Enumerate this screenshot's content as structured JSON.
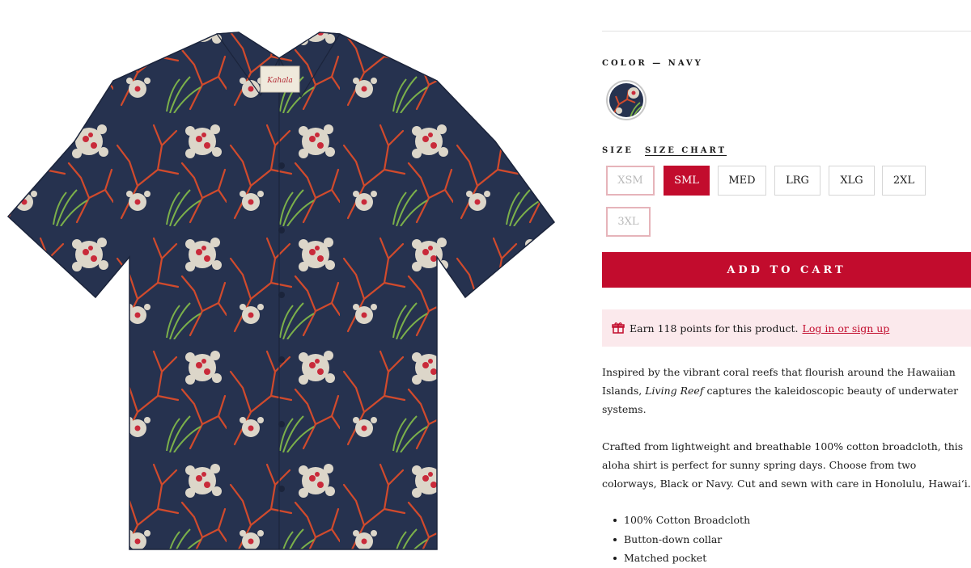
{
  "product": {
    "image_alt": "Living Reef aloha shirt in Navy",
    "brand_tag": "Kahala"
  },
  "color": {
    "label": "COLOR — NAVY",
    "swatches": [
      {
        "name": "Navy",
        "selected": true
      }
    ]
  },
  "size": {
    "label": "SIZE",
    "chart_link": "SIZE CHART",
    "options": [
      {
        "label": "XSM",
        "state": "unavailable"
      },
      {
        "label": "SML",
        "state": "selected"
      },
      {
        "label": "MED",
        "state": "available"
      },
      {
        "label": "LRG",
        "state": "available"
      },
      {
        "label": "XLG",
        "state": "available"
      },
      {
        "label": "2XL",
        "state": "available"
      },
      {
        "label": "3XL",
        "state": "unavailable"
      }
    ]
  },
  "cart": {
    "add_label": "ADD TO CART"
  },
  "rewards": {
    "text": "Earn 118 points for this product.",
    "link": "Log in or sign up"
  },
  "description": {
    "p1_before": "Inspired by the vibrant coral reefs that flourish around the Hawaiian Islands,",
    "p1_em": "Living Reef",
    "p1_after": "captures the kaleidoscopic beauty of underwater systems.",
    "p2": "Crafted from lightweight and breathable 100% cotton broadcloth, this aloha shirt is perfect for sunny spring days. Choose from two colorways, Black or Navy. Cut and sewn with care in Honolulu, Hawai‘i."
  },
  "features": [
    "100% Cotton Broadcloth",
    "Button-down collar",
    "Matched pocket"
  ],
  "colors": {
    "accent": "#c20c2d",
    "rewards_bg": "#fbe9ec",
    "shirt_navy": "#26324f"
  }
}
